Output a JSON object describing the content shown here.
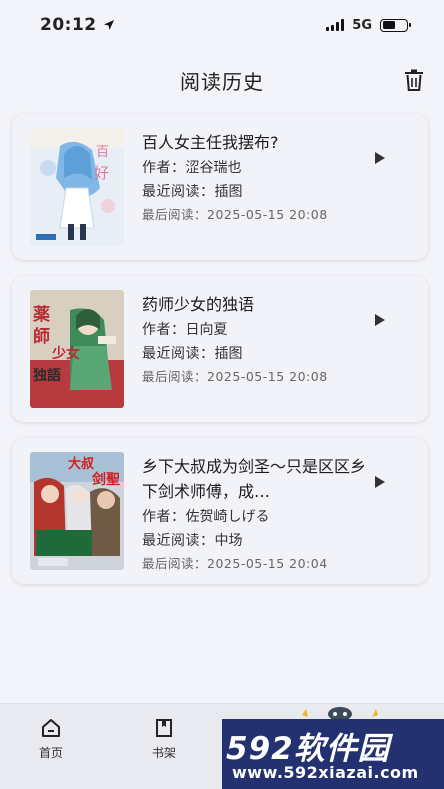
{
  "status_bar": {
    "time": "20:12",
    "network": "5G"
  },
  "header": {
    "title": "阅读历史"
  },
  "books": [
    {
      "title": "百人女主任我摆布?",
      "author_label": "作者：",
      "author": "涩谷瑞也",
      "recent_label": "最近阅读：",
      "recent": "插图",
      "last_label": "最后阅读：",
      "last_time": "2025-05-15 20:08"
    },
    {
      "title": "药师少女的独语",
      "author_label": "作者：",
      "author": "日向夏",
      "recent_label": "最近阅读：",
      "recent": "插图",
      "last_label": "最后阅读：",
      "last_time": "2025-05-15 20:08"
    },
    {
      "title": "乡下大叔成为剑圣～只是区区乡下剑术师傅，成…",
      "author_label": "作者：",
      "author": "佐贺崎しげる",
      "recent_label": "最近阅读：",
      "recent": "中场",
      "last_label": "最后阅读：",
      "last_time": "2025-05-15 20:04"
    }
  ],
  "nav": {
    "home": "首页",
    "shelf": "书架"
  },
  "watermark": {
    "logo": "592软件园",
    "url": "www.592xiazai.com"
  },
  "icons": [
    "location-arrow-icon",
    "signal-icon",
    "battery-icon",
    "trash-icon",
    "play-icon",
    "home-icon",
    "bookshelf-icon"
  ]
}
